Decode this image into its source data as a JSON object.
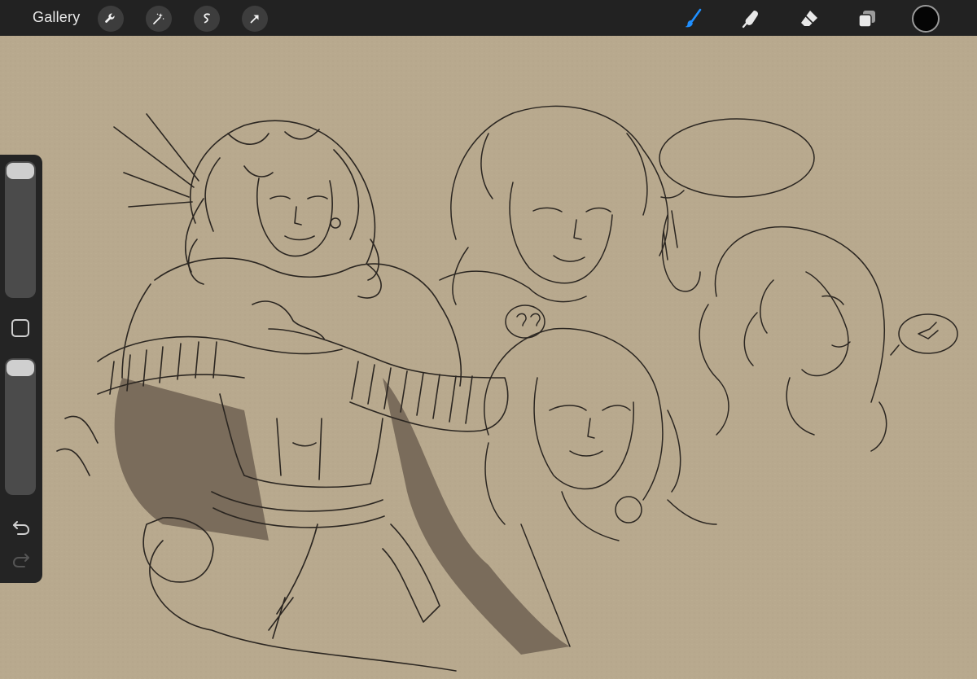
{
  "toolbar": {
    "gallery_label": "Gallery",
    "left_tools": [
      {
        "icon": "wrench-icon",
        "name": "actions"
      },
      {
        "icon": "magic-wand-icon",
        "name": "adjustments"
      },
      {
        "icon": "selection-icon",
        "name": "selection"
      },
      {
        "icon": "transform-arrow-icon",
        "name": "transform"
      }
    ],
    "right_tools": [
      {
        "icon": "brush-icon",
        "name": "paint",
        "active": true
      },
      {
        "icon": "smudge-icon",
        "name": "smudge",
        "active": false
      },
      {
        "icon": "eraser-icon",
        "name": "erase",
        "active": false
      },
      {
        "icon": "layers-icon",
        "name": "layers",
        "active": false
      }
    ],
    "current_color": "#050505",
    "active_tool_color": "#1f8fff"
  },
  "sidebar": {
    "brush_size_level": 0.0,
    "opacity_level": 0.0,
    "modify_icon": "square-icon",
    "undo_icon": "undo-icon",
    "redo_icon": "redo-icon",
    "redo_enabled": false
  },
  "canvas": {
    "background_color": "#b8a98e",
    "ink_color": "#2b2621",
    "shadow_tone": "#7a6c5a"
  }
}
